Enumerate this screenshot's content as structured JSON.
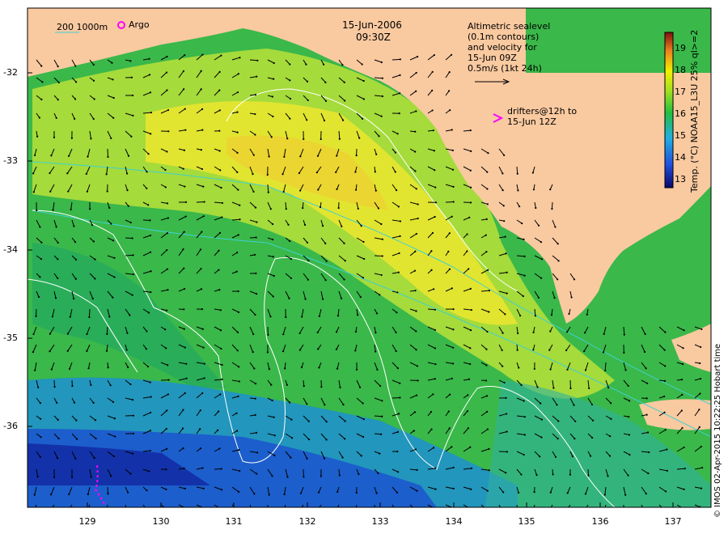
{
  "map": {
    "date": "15-Jun-2006",
    "time": "09:30Z",
    "legend_isobaths": "200  1000m",
    "legend_argo": "Argo",
    "altimetry_note": [
      "Altimetric sealevel",
      "(0.1m contours)",
      "and velocity for",
      "15-Jun 09Z",
      "0.5m/s (1kt 24h)"
    ],
    "drifters_note": [
      "drifters@12h to",
      "15-Jun 12Z"
    ],
    "credit": "© IMOS 02-Apr-2015 10:22:25 Hobart time",
    "colorbar_title": "Temp. (°C) NOAA15_L3U 25% ql>=2",
    "colorbar_ticks": [
      "19",
      "18",
      "17",
      "16",
      "15",
      "14",
      "13"
    ],
    "lat_ticks": [
      "-32",
      "-33",
      "-34",
      "-35",
      "-36"
    ],
    "lon_ticks": [
      "129",
      "130",
      "131",
      "132",
      "133",
      "134",
      "135",
      "136",
      "137"
    ],
    "colors": {
      "land": "#f9c9a0",
      "text": "#000000",
      "argo": "#ff00ff",
      "isobath": "#40d0d0"
    }
  }
}
